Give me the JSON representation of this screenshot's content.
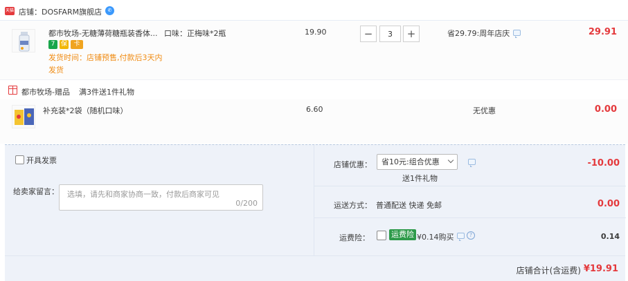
{
  "shop": {
    "badge": "天猫",
    "name": "店铺：DOSFARM旗舰店",
    "wangwang_icon": "wangwang-icon"
  },
  "item1": {
    "title": "都市牧场-无糖薄荷糖瓶装香体...",
    "sku_label": "口味：",
    "sku_value": "正梅味*2瓶",
    "service_badges": [
      "7",
      "保",
      "卡"
    ],
    "delivery": "发货时间：店铺预售,付款后3天内发货",
    "price": "19.90",
    "quantity": "3",
    "minus": "−",
    "plus": "+",
    "discount": "省29.79:周年店庆",
    "subtotal": "29.91"
  },
  "gift": {
    "title": "都市牧场-赠品",
    "rule": "满3件送1件礼物"
  },
  "item2": {
    "title": "补充装*2袋（随机口味）",
    "price": "6.60",
    "discount": "无优惠",
    "subtotal": "0.00"
  },
  "order": {
    "invoice_label": "开具发票",
    "message_label": "给卖家留言：",
    "message_placeholder": "选填，请先和商家协商一致，付款后商家可见",
    "message_count": "0/200",
    "shop_discount_label": "店铺优惠：",
    "shop_discount_option": "省10元:组合优惠",
    "shop_discount_gift": "送1件礼物",
    "shop_discount_amount": "-10.00",
    "shipping_label": "运送方式：",
    "shipping_method": "普通配送 快递 免邮",
    "shipping_amount": "0.00",
    "insurance_label": "运费险：",
    "insurance_badge": "运费险",
    "insurance_price": "¥0.14购买",
    "insurance_amount": "0.14",
    "total_label": "店铺合计(含运费)",
    "total_value": "¥19.91"
  },
  "colors": {
    "accent_red": "#e4393c",
    "delivery_orange": "#f08c14",
    "panel_bg": "#eef2f9",
    "insurance_green": "#2e9a4a"
  }
}
